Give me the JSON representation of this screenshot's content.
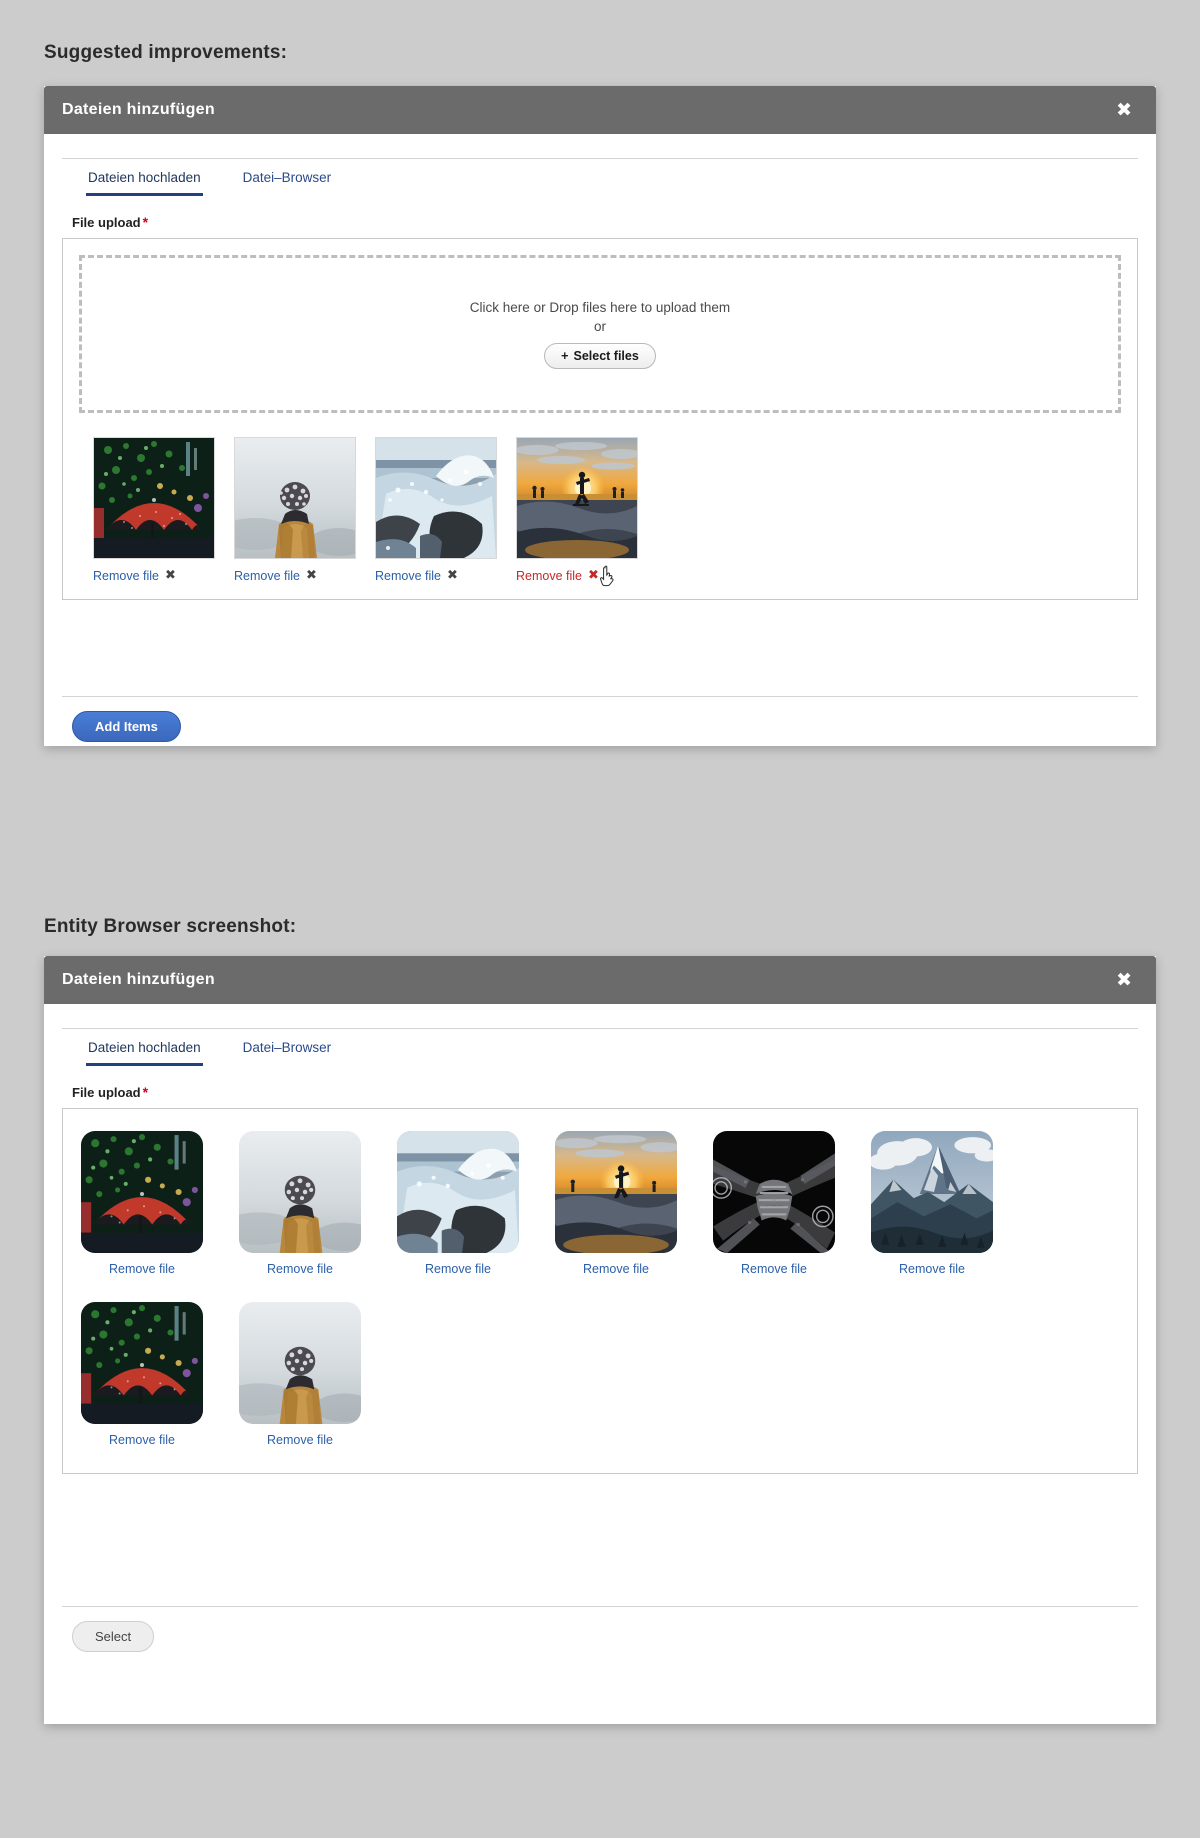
{
  "page": {
    "background_color": "#cccccc",
    "heading_improvements": "Suggested improvements:",
    "heading_entity_browser": "Entity Browser screenshot:"
  },
  "colors": {
    "header_bar": "#6b6b6b",
    "tab_active": "#22417e",
    "link_blue": "#2b5fa8",
    "required_red": "#d0021b",
    "hover_red": "#c62828",
    "primary_button": "#3a68bd"
  },
  "dialog_improvements": {
    "title": "Dateien hinzufügen",
    "close_icon": "close-icon",
    "close_label": "✖",
    "tabs": [
      {
        "label": "Dateien hochladen",
        "active": true
      },
      {
        "label": "Datei–Browser",
        "active": false
      }
    ],
    "field_label": "File upload",
    "required_marker": "*",
    "dropzone": {
      "primary_text": "Click here or Drop files here to upload them",
      "or_text": "or",
      "button_plus": "+",
      "button_label": "Select files"
    },
    "files": [
      {
        "alt": "red umbrella at night in the rain",
        "remove_label": "Remove file",
        "remove_icon": "✖",
        "hovered": false
      },
      {
        "alt": "person in yellow jacket and beanie in fog",
        "remove_label": "Remove file",
        "remove_icon": "✖",
        "hovered": false
      },
      {
        "alt": "ocean wave crashing over dark rocks",
        "remove_label": "Remove file",
        "remove_icon": "✖",
        "hovered": false
      },
      {
        "alt": "skateboarder silhouette at sunset in skate bowl",
        "remove_label": "Remove file",
        "remove_icon": "✖",
        "hovered": true
      }
    ],
    "footer": {
      "submit_label": "Add Items"
    }
  },
  "dialog_entity_browser": {
    "title": "Dateien hinzufügen",
    "close_icon": "close-icon",
    "close_label": "✖",
    "tabs": [
      {
        "label": "Dateien hochladen",
        "active": true
      },
      {
        "label": "Datei–Browser",
        "active": false
      }
    ],
    "field_label": "File upload",
    "required_marker": "*",
    "files": [
      {
        "alt": "red umbrella at night in the rain",
        "remove_label": "Remove file"
      },
      {
        "alt": "person in yellow jacket and beanie in fog",
        "remove_label": "Remove file"
      },
      {
        "alt": "ocean wave crashing over dark rocks",
        "remove_label": "Remove file"
      },
      {
        "alt": "skateboarder silhouette at sunset in skate bowl",
        "remove_label": "Remove file"
      },
      {
        "alt": "dark cathedral vaulted ceiling looking up",
        "remove_label": "Remove file"
      },
      {
        "alt": "snow covered mountain peak with clouds",
        "remove_label": "Remove file"
      },
      {
        "alt": "red umbrella at night in the rain",
        "remove_label": "Remove file"
      },
      {
        "alt": "person in yellow jacket and beanie in fog",
        "remove_label": "Remove file"
      }
    ],
    "footer": {
      "submit_label": "Select"
    }
  }
}
